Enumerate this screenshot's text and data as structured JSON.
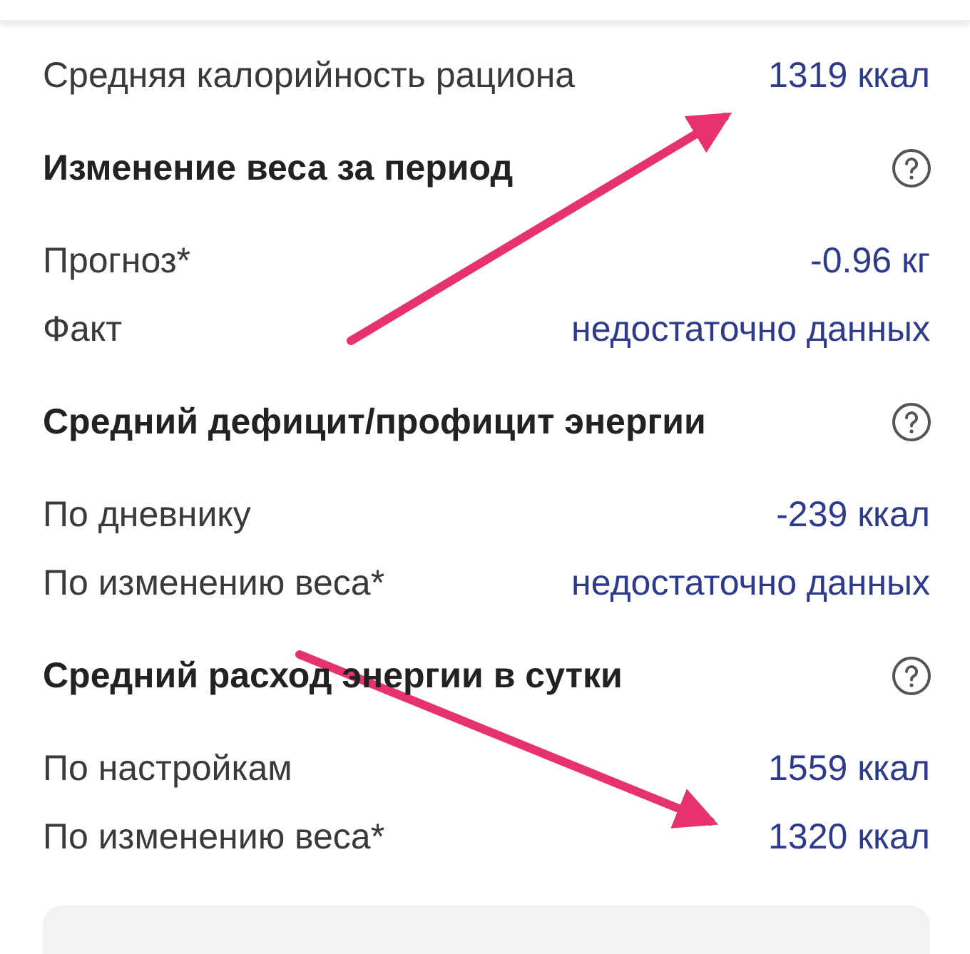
{
  "summary": {
    "label": "Средняя калорийность рациона",
    "value": "1319 ккал"
  },
  "sections": [
    {
      "title": "Изменение веса за период",
      "rows": [
        {
          "label": "Прогноз*",
          "value": "-0.96 кг"
        },
        {
          "label": "Факт",
          "value": "недостаточно данных"
        }
      ]
    },
    {
      "title": "Средний дефицит/профицит энергии",
      "rows": [
        {
          "label": "По дневнику",
          "value": "-239 ккал"
        },
        {
          "label": "По изменению веса*",
          "value": "недостаточно данных"
        }
      ]
    },
    {
      "title": "Средний расход энергии в сутки",
      "rows": [
        {
          "label": "По настройкам",
          "value": "1559 ккал"
        },
        {
          "label": "По изменению веса*",
          "value": "1320 ккал"
        }
      ]
    }
  ]
}
